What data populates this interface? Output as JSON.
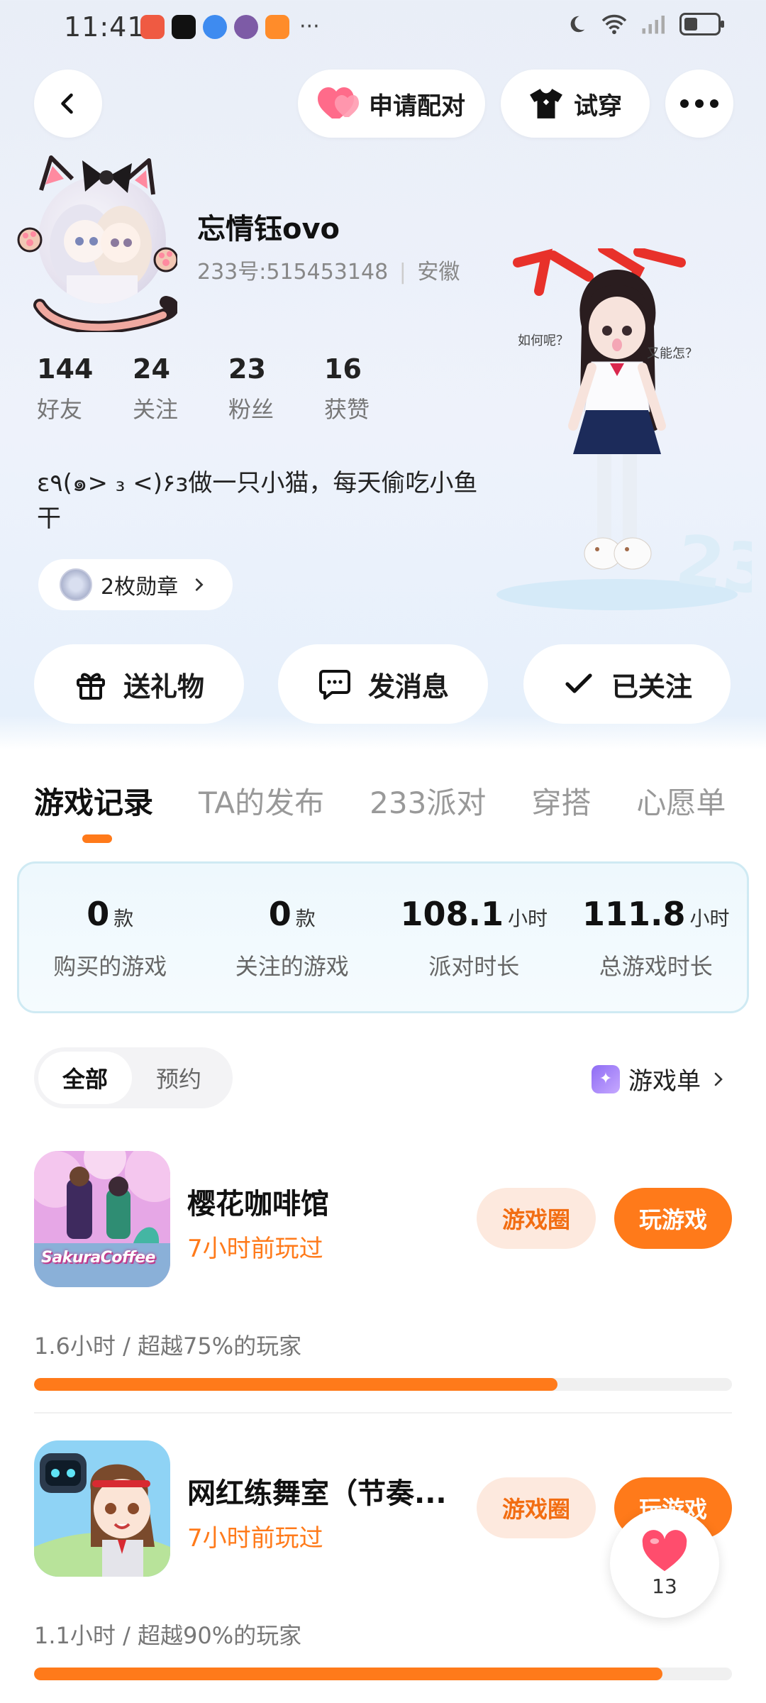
{
  "status_bar": {
    "time": "11:41"
  },
  "nav": {
    "match_label": "申请配对",
    "try_label": "试穿"
  },
  "profile": {
    "username": "忘情钰ovo",
    "uid_line": "233号:515453148",
    "location": "安徽",
    "stats": [
      {
        "value": "144",
        "label": "好友"
      },
      {
        "value": "24",
        "label": "关注"
      },
      {
        "value": "23",
        "label": "粉丝"
      },
      {
        "value": "16",
        "label": "获赞"
      }
    ],
    "bio": "ε٩(๑> ₃ <)۶з做一只小猫，每天偷吃小鱼干",
    "medal_label": "2枚勋章",
    "character_captions": {
      "left": "如何呢？",
      "right": "又能怎？"
    }
  },
  "actions": {
    "gift": "送礼物",
    "message": "发消息",
    "followed": "已关注"
  },
  "tabs": [
    "游戏记录",
    "TA的发布",
    "233派对",
    "穿搭",
    "心愿单"
  ],
  "summary": [
    {
      "value": "0",
      "unit": "款",
      "label": "购买的游戏"
    },
    {
      "value": "0",
      "unit": "款",
      "label": "关注的游戏"
    },
    {
      "value": "108.1",
      "unit": "小时",
      "label": "派对时长"
    },
    {
      "value": "111.8",
      "unit": "小时",
      "label": "总游戏时长"
    }
  ],
  "filter": {
    "all": "全部",
    "reserve": "预约"
  },
  "game_list_link": "游戏单",
  "games": [
    {
      "name": "樱花咖啡馆",
      "last_played": "7小时前玩过",
      "stat_line": "1.6小时 / 超越75%的玩家",
      "progress": 0.75,
      "circle_label": "游戏圈",
      "play_label": "玩游戏",
      "thumb_text": "SakuraCoffee"
    },
    {
      "name": "网红练舞室（节奏...",
      "last_played": "7小时前玩过",
      "stat_line": "1.1小时 / 超越90%的玩家",
      "progress": 0.9,
      "circle_label": "游戏圈",
      "play_label": "玩游戏"
    }
  ],
  "like_fab": {
    "count": "13"
  },
  "colors": {
    "accent": "#ff7a1a",
    "accent_light": "#fde9de",
    "heart": "#ff4d6d"
  }
}
